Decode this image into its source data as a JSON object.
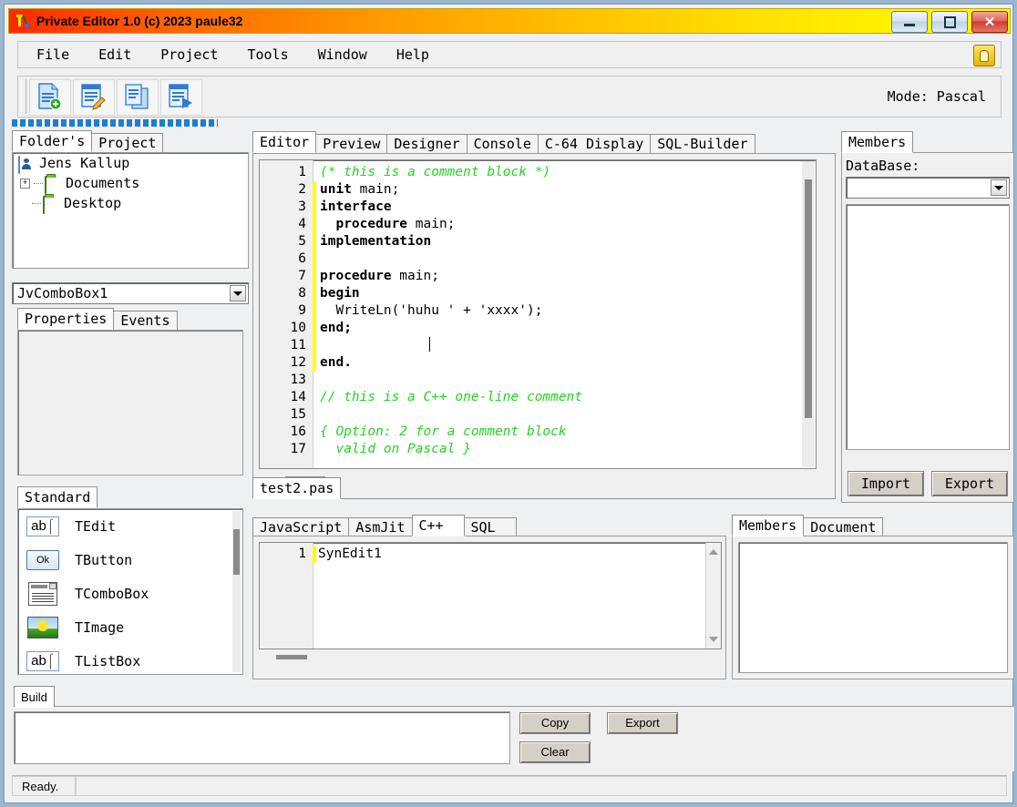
{
  "window": {
    "title": "Private Editor 1.0 (c) 2023 paule32",
    "icon": "app-icon",
    "minimize_label": "",
    "maximize_label": "",
    "close_label": "✕"
  },
  "menu": {
    "items": [
      "File",
      "Edit",
      "Project",
      "Tools",
      "Window",
      "Help"
    ],
    "hint_icon": "lightbulb-icon"
  },
  "toolbar": {
    "buttons": [
      {
        "name": "new-file-button",
        "icon": "new-document-icon"
      },
      {
        "name": "edit-file-button",
        "icon": "edit-document-icon"
      },
      {
        "name": "copy-file-button",
        "icon": "copy-document-icon"
      },
      {
        "name": "run-button",
        "icon": "run-document-icon"
      }
    ],
    "mode_label": "Mode: Pascal"
  },
  "left_panel": {
    "tabs": [
      {
        "label": "Folder's",
        "selected": true
      },
      {
        "label": "Project",
        "selected": false
      }
    ],
    "tree": [
      {
        "label": "Jens Kallup",
        "icon": "user-icon",
        "indent": 0,
        "expander": ""
      },
      {
        "label": "Documents",
        "icon": "folder-icon",
        "indent": 1,
        "expander": "+"
      },
      {
        "label": "Desktop",
        "icon": "folder-icon",
        "indent": 1,
        "expander": ""
      }
    ],
    "object_combo": {
      "value": "JvComboBox1",
      "placeholder": ""
    },
    "inspector_tabs": [
      {
        "label": "Properties",
        "selected": true
      },
      {
        "label": "Events",
        "selected": false
      }
    ],
    "palette_tabs": [
      {
        "label": "Standard",
        "selected": true
      }
    ],
    "palette_items": [
      {
        "label": "TEdit",
        "icon": "edit-component-icon",
        "glyph": "ab"
      },
      {
        "label": "TButton",
        "icon": "button-component-icon",
        "glyph": "Ok"
      },
      {
        "label": "TComboBox",
        "icon": "combobox-component-icon",
        "glyph": ""
      },
      {
        "label": "TImage",
        "icon": "image-component-icon",
        "glyph": ""
      },
      {
        "label": "TListBox",
        "icon": "listbox-component-icon",
        "glyph": "ab"
      }
    ]
  },
  "editor": {
    "tabs": [
      {
        "label": "Editor",
        "selected": true
      },
      {
        "label": "Preview",
        "selected": false
      },
      {
        "label": "Designer",
        "selected": false
      },
      {
        "label": "Console",
        "selected": false
      },
      {
        "label": "C-64 Display",
        "selected": false
      },
      {
        "label": "SQL-Builder",
        "selected": false
      }
    ],
    "file_tabs": [
      {
        "label": "test2.pas",
        "selected": true
      }
    ],
    "modified_marker_color": "#ffff00",
    "comment_color": "#25d425",
    "lines": [
      {
        "n": 1,
        "tokens": [
          {
            "t": "(* this is a comment block *)",
            "c": "cm"
          }
        ]
      },
      {
        "n": 2,
        "tokens": [
          {
            "t": "unit",
            "c": "kw"
          },
          {
            "t": " main;",
            "c": ""
          }
        ]
      },
      {
        "n": 3,
        "tokens": [
          {
            "t": "interface",
            "c": "kw"
          }
        ]
      },
      {
        "n": 4,
        "tokens": [
          {
            "t": "  ",
            "c": ""
          },
          {
            "t": "procedure",
            "c": "kw"
          },
          {
            "t": " main;",
            "c": ""
          }
        ]
      },
      {
        "n": 5,
        "tokens": [
          {
            "t": "implementation",
            "c": "kw"
          }
        ]
      },
      {
        "n": 6,
        "tokens": []
      },
      {
        "n": 7,
        "tokens": [
          {
            "t": "procedure",
            "c": "kw"
          },
          {
            "t": " main;",
            "c": ""
          }
        ]
      },
      {
        "n": 8,
        "tokens": [
          {
            "t": "begin",
            "c": "kw"
          }
        ]
      },
      {
        "n": 9,
        "tokens": [
          {
            "t": "  WriteLn('huhu ' + 'xxxx');",
            "c": ""
          }
        ]
      },
      {
        "n": 10,
        "tokens": [
          {
            "t": "end;",
            "c": "kw"
          }
        ]
      },
      {
        "n": 11,
        "tokens": []
      },
      {
        "n": 12,
        "tokens": [
          {
            "t": "end.",
            "c": "kw"
          }
        ]
      },
      {
        "n": 13,
        "tokens": []
      },
      {
        "n": 14,
        "tokens": [
          {
            "t": "// this is a C++ one-line comment",
            "c": "cm"
          }
        ]
      },
      {
        "n": 15,
        "tokens": []
      },
      {
        "n": 16,
        "tokens": [
          {
            "t": "{ Option: 2 for a comment block",
            "c": "cm"
          }
        ]
      },
      {
        "n": 17,
        "tokens": [
          {
            "t": "  valid on Pascal }",
            "c": "cm"
          }
        ]
      }
    ]
  },
  "members_panel": {
    "tabs": [
      {
        "label": "Members",
        "selected": true
      }
    ],
    "database_label": "DataBase:",
    "database_value": "",
    "import_label": "Import",
    "export_label": "Export"
  },
  "bottom_editor": {
    "tabs": [
      {
        "label": "JavaScript",
        "selected": false
      },
      {
        "label": "AsmJit",
        "selected": false
      },
      {
        "label": "C++",
        "selected": true
      },
      {
        "label": "SQL",
        "selected": false
      }
    ],
    "lines": [
      {
        "n": 1,
        "text": "SynEdit1"
      }
    ]
  },
  "bottom_members": {
    "tabs": [
      {
        "label": "Members",
        "selected": true
      },
      {
        "label": "Document",
        "selected": false
      }
    ]
  },
  "build": {
    "tabs": [
      {
        "label": "Build",
        "selected": true
      }
    ],
    "output": "",
    "copy_label": "Copy",
    "export_label": "Export",
    "clear_label": "Clear"
  },
  "status": {
    "text": "Ready.",
    "second": ""
  }
}
